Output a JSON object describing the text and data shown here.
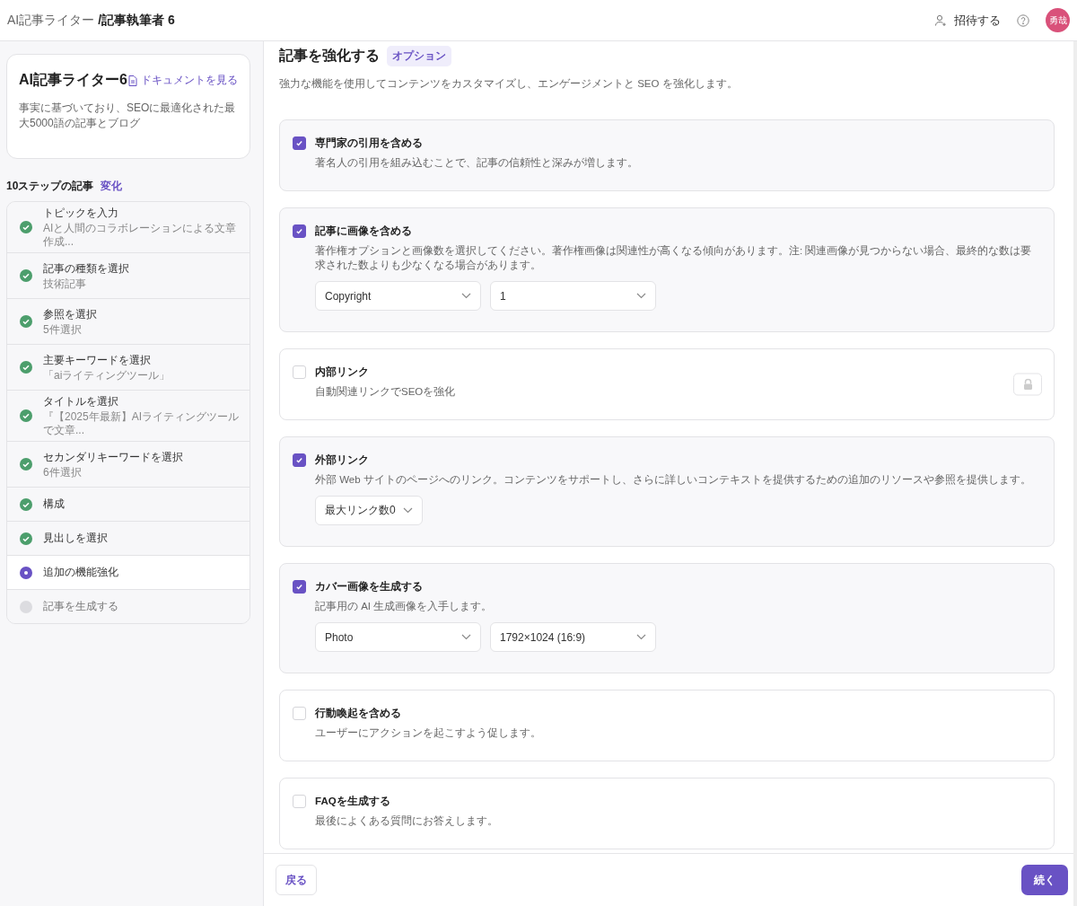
{
  "header": {
    "breadcrumb_parent": "AI記事ライター",
    "breadcrumb_current": "/記事執筆者 6",
    "invite": "招待する",
    "avatar": "勇哉"
  },
  "sidebar": {
    "title": "AI記事ライター6",
    "docs_link": "ドキュメントを見る",
    "description": "事実に基づいており、SEOに最適化された最大5000語の記事とブログ",
    "steps_heading": "10ステップの記事",
    "steps_action": "変化",
    "steps": [
      {
        "label": "トピックを入力",
        "detail": "AIと人間のコラボレーションによる文章作成...",
        "kind": "done"
      },
      {
        "label": "記事の種類を選択",
        "detail": "技術記事",
        "kind": "done"
      },
      {
        "label": "参照を選択",
        "detail": "5件選択",
        "kind": "done"
      },
      {
        "label": "主要キーワードを選択",
        "detail": "「aiライティングツール」",
        "kind": "done"
      },
      {
        "label": "タイトルを選択",
        "detail": "『【2025年最新】AIライティングツールで文章...",
        "kind": "done"
      },
      {
        "label": "セカンダリキーワードを選択",
        "detail": "6件選択",
        "kind": "done"
      },
      {
        "label": "構成",
        "kind": "done"
      },
      {
        "label": "見出しを選択",
        "kind": "done"
      },
      {
        "label": "追加の機能強化",
        "kind": "current"
      },
      {
        "label": "記事を生成する",
        "kind": "pending"
      }
    ]
  },
  "main": {
    "title": "記事を強化する",
    "badge": "オプション",
    "subtitle": "強力な機能を使用してコンテンツをカスタマイズし、エンゲージメントと SEO を強化します。",
    "options": [
      {
        "title": "専門家の引用を含める",
        "description": "著名人の引用を組み込むことで、記事の信頼性と深みが増します。",
        "checked": true
      },
      {
        "title": "記事に画像を含める",
        "description": "著作権オプションと画像数を選択してください。著作権画像は関連性が高くなる傾向があります。注: 関連画像が見つからない場合、最終的な数は要求された数よりも少なくなる場合があります。",
        "checked": true,
        "selects": [
          {
            "value": "Copyright",
            "kind": "wide"
          },
          {
            "value": "1",
            "kind": "wide"
          }
        ]
      },
      {
        "title": "内部リンク",
        "description": "自動関連リンクでSEOを強化",
        "checked": false,
        "locked": true
      },
      {
        "title": "外部リンク",
        "description": "外部 Web サイトのページへのリンク。コンテンツをサポートし、さらに詳しいコンテキストを提供するための追加のリソースや参照を提供します。",
        "checked": true,
        "selects": [
          {
            "value": "最大リンク数0",
            "kind": "narrow"
          }
        ]
      },
      {
        "title": "カバー画像を生成する",
        "description": "記事用の AI 生成画像を入手します。",
        "checked": true,
        "selects": [
          {
            "value": "Photo",
            "kind": "wide"
          },
          {
            "value": "1792×1024 (16:9)",
            "kind": "wide"
          }
        ]
      },
      {
        "title": "行動喚起を含める",
        "description": "ユーザーにアクションを起こすよう促します。",
        "checked": false
      },
      {
        "title": "FAQを生成する",
        "description": "最後によくある質問にお答えします。",
        "checked": false
      }
    ]
  },
  "footer": {
    "back": "戻る",
    "next": "続く"
  }
}
